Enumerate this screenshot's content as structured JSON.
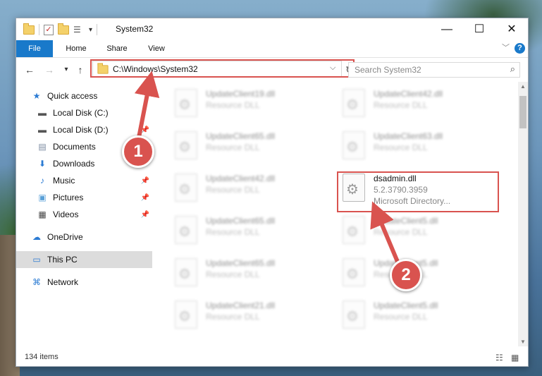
{
  "window": {
    "title": "System32",
    "controls": {
      "minimize": "—",
      "maximize": "☐",
      "close": "✕"
    }
  },
  "quick_access_toolbar": {
    "dropdown_glyph": "▾",
    "icons": [
      "folder-icon",
      "properties-icon",
      "new-folder-icon",
      "customize-icon"
    ]
  },
  "ribbon": {
    "tabs": [
      "File",
      "Home",
      "Share",
      "View"
    ],
    "help_glyph": "?",
    "collapse_glyph": "﹀",
    "accent_color": "#1979ca"
  },
  "nav": {
    "back_glyph": "←",
    "forward_glyph": "→",
    "recent_glyph": "▾",
    "up_glyph": "↑",
    "address": "C:\\Windows\\System32",
    "address_dropdown_glyph": "⌵",
    "refresh_glyph": "↻",
    "search_placeholder": "Search System32",
    "search_glyph": "⌕"
  },
  "sidebar": {
    "items": [
      {
        "label": "Quick access",
        "icon": "star-icon",
        "glyph": "★",
        "color": "#2b7bd3",
        "pinned": false
      },
      {
        "label": "Local Disk (C:)",
        "icon": "drive-icon",
        "glyph": "▬",
        "color": "#555555",
        "pinned": true
      },
      {
        "label": "Local Disk (D:)",
        "icon": "drive-icon",
        "glyph": "▬",
        "color": "#555555",
        "pinned": true
      },
      {
        "label": "Documents",
        "icon": "documents-icon",
        "glyph": "▤",
        "color": "#7a8aa0",
        "pinned": true
      },
      {
        "label": "Downloads",
        "icon": "downloads-icon",
        "glyph": "⬇",
        "color": "#2b7bd3",
        "pinned": true
      },
      {
        "label": "Music",
        "icon": "music-icon",
        "glyph": "♪",
        "color": "#2b7bd3",
        "pinned": true
      },
      {
        "label": "Pictures",
        "icon": "pictures-icon",
        "glyph": "▣",
        "color": "#5aa0d8",
        "pinned": true
      },
      {
        "label": "Videos",
        "icon": "videos-icon",
        "glyph": "▦",
        "color": "#444444",
        "pinned": true
      },
      {
        "label": "OneDrive",
        "icon": "cloud-icon",
        "glyph": "☁",
        "color": "#2b7bd3",
        "pinned": false
      },
      {
        "label": "This PC",
        "icon": "computer-icon",
        "glyph": "▭",
        "color": "#2b7bd3",
        "pinned": false,
        "selected": true
      },
      {
        "label": "Network",
        "icon": "network-icon",
        "glyph": "⌘",
        "color": "#2b7bd3",
        "pinned": false
      }
    ],
    "pin_glyph": "📌"
  },
  "files": [
    {
      "name": "UpdateClient19.dll",
      "desc": "Resource DLL",
      "blurred": true
    },
    {
      "name": "UpdateClient42.dll",
      "desc": "Resource DLL",
      "blurred": true
    },
    {
      "name": "UpdateClient65.dll",
      "desc": "Resource DLL",
      "blurred": true
    },
    {
      "name": "UpdateClient63.dll",
      "desc": "Resource DLL",
      "blurred": true
    },
    {
      "name": "UpdateClient42.dll",
      "desc": "Resource DLL",
      "blurred": true
    },
    {
      "name": "dsadmin.dll",
      "desc": "5.2.3790.3959",
      "desc2": "Microsoft Directory...",
      "blurred": false
    },
    {
      "name": "UpdateClient65.dll",
      "desc": "Resource DLL",
      "blurred": true
    },
    {
      "name": "UpdateClient5.dll",
      "desc": "Resource DLL",
      "blurred": true
    },
    {
      "name": "UpdateClient65.dll",
      "desc": "Resource DLL",
      "blurred": true
    },
    {
      "name": "UpdateClient5.dll",
      "desc": "Resource DLL",
      "blurred": true
    },
    {
      "name": "UpdateClient21.dll",
      "desc": "Resource DLL",
      "blurred": true
    },
    {
      "name": "UpdateClient5.dll",
      "desc": "Resource DLL",
      "blurred": true
    }
  ],
  "status": {
    "item_count": "134 items"
  },
  "annotations": {
    "badge1": "1",
    "badge2": "2",
    "highlight_color": "#d9534f"
  }
}
